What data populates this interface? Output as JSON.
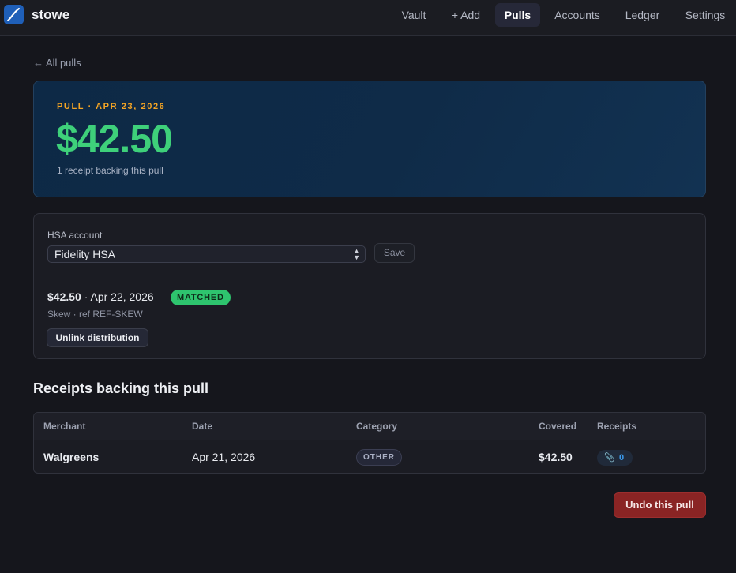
{
  "app": {
    "brand": "stowe",
    "logo_icon": "stowe-logo-icon",
    "nav": [
      {
        "label": "Vault",
        "active": false
      },
      {
        "label": "+ Add",
        "active": false
      },
      {
        "label": "Pulls",
        "active": true
      },
      {
        "label": "Accounts",
        "active": false
      },
      {
        "label": "Ledger",
        "active": false
      },
      {
        "label": "Settings",
        "active": false
      }
    ]
  },
  "back_link": "← All pulls",
  "hero": {
    "kicker": "PULL · APR 23, 2026",
    "amount": "$42.50",
    "subtitle": "1 receipt backing this pull"
  },
  "account": {
    "label": "HSA account",
    "selected": "Fidelity HSA",
    "save_label": "Save"
  },
  "distribution": {
    "amount": "$42.50",
    "date": "· Apr 22, 2026",
    "status": "MATCHED",
    "meta": "Skew · ref REF-SKEW",
    "unlink_label": "Unlink distribution"
  },
  "receipts": {
    "title": "Receipts backing this pull",
    "columns": [
      "Merchant",
      "Date",
      "Category",
      "Covered",
      "Receipts"
    ],
    "rows": [
      {
        "merchant": "Walgreens",
        "date": "Apr 21, 2026",
        "category": "OTHER",
        "covered": "$42.50",
        "receipts_count": "0",
        "receipts_icon": "paperclip-icon"
      }
    ]
  },
  "undo_label": "Undo this pull",
  "colors": {
    "accent_green": "#3ed07a",
    "kicker_orange": "#f5a524",
    "danger": "#8a2424",
    "link_blue": "#3b9cf0"
  }
}
